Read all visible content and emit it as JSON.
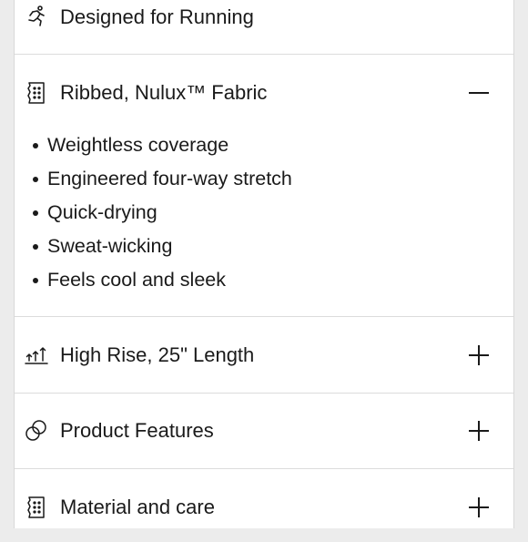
{
  "accordion": {
    "sections": [
      {
        "title": "Designed for Running",
        "icon": "running-person-icon"
      },
      {
        "title": "Ribbed, Nulux™ Fabric",
        "icon": "fabric-swatch-icon",
        "expanded": true,
        "bullets": [
          "Weightless coverage",
          "Engineered four-way stretch",
          "Quick-drying",
          "Sweat-wicking",
          "Feels cool and sleek"
        ],
        "toggle_icon": "minus-icon"
      },
      {
        "title": "High Rise, 25\" Length",
        "icon": "rise-length-icon",
        "toggle_icon": "plus-icon"
      },
      {
        "title": "Product Features",
        "icon": "product-features-icon",
        "toggle_icon": "plus-icon"
      },
      {
        "title": "Material and care",
        "icon": "fabric-swatch-icon",
        "toggle_icon": "plus-icon"
      }
    ]
  }
}
